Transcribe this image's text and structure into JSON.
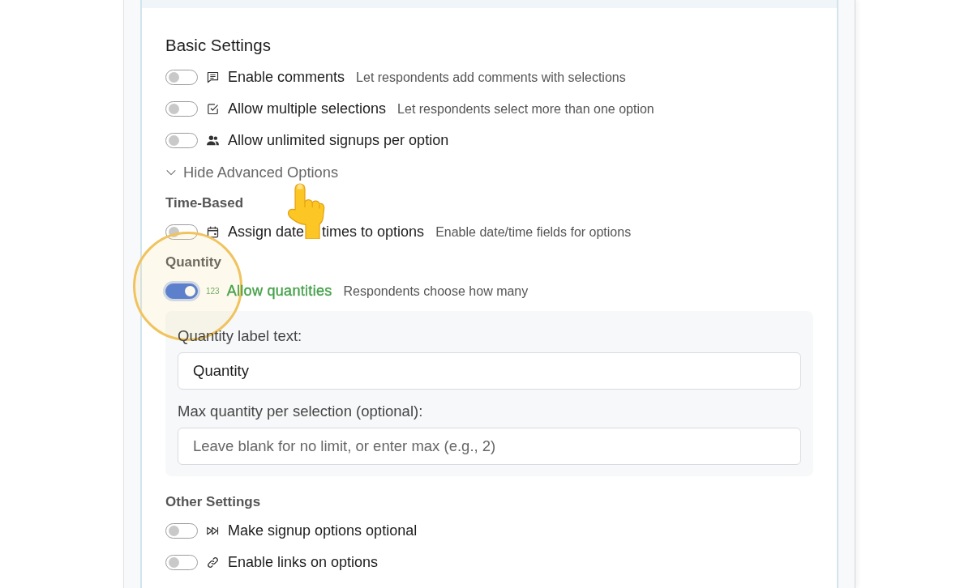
{
  "basic_settings": {
    "title": "Basic Settings",
    "options": [
      {
        "label": "Enable comments",
        "description": "Let respondents add comments with selections",
        "on": false
      },
      {
        "label": "Allow multiple selections",
        "description": "Let respondents select more than one option",
        "on": false
      },
      {
        "label": "Allow unlimited signups per option",
        "on": false
      }
    ]
  },
  "advanced_toggle": {
    "label": "Hide Advanced Options",
    "expanded": true
  },
  "advanced_sections": [
    {
      "title": "Time-Based",
      "options": [
        {
          "label_parts": [
            "Assign date",
            "times to options"
          ],
          "pointer": true,
          "description": "Enable date/time fields for options",
          "on": false
        }
      ]
    },
    {
      "title": "Quantity",
      "options": [
        {
          "label": "Allow quantities",
          "icon_text": "123",
          "description": "Respondents choose how many",
          "on": true,
          "highlighted": true,
          "fields": [
            {
              "label": "Quantity label text:",
              "value": "Quantity"
            },
            {
              "label": "Max quantity per selection (optional):",
              "placeholder": "Leave blank for no limit, or enter max (e.g., 2)"
            }
          ]
        }
      ]
    },
    {
      "title": "Other Settings",
      "options": [
        {
          "label": "Make signup options optional",
          "on": false
        },
        {
          "label": "Enable links on options",
          "on": false
        }
      ]
    }
  ]
}
